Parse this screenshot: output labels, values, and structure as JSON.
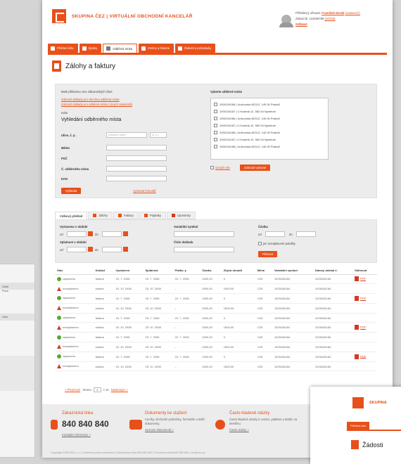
{
  "header": {
    "brand": "SKUPINA ČEZ | VIRTUÁLNÍ OBCHODNÍ KANCELÁŘ",
    "user": {
      "line1_label": "Přihlášený uživatel:",
      "line1_name": "František Novák",
      "line1_link": "(nastavení)",
      "line2_label": "Zákazník: 123456789",
      "line2_link": "(změnit)",
      "logout": "Odhlásit"
    }
  },
  "tabs": [
    {
      "label": "Přehled účtu"
    },
    {
      "label": "Zprávy"
    },
    {
      "label": "Odběrná místa"
    },
    {
      "label": "Změny a historie"
    },
    {
      "label": "Žádosti a požadavky"
    }
  ],
  "page_title": "Zálohy a faktury",
  "search": {
    "intro": "Malé přiřazeno více zákaznických čísel",
    "link1": "Zobrazit doklady pro všechna odběrná místa",
    "link2": "Zobrazit doklady pro odběrná místa z jiných zákazníků",
    "or": "nebo",
    "heading": "Vyhledání odběrného místa",
    "fields": [
      {
        "label": "Ulice, č. p.",
        "placeholder": "(názvem ulice)",
        "placeholder2": "(č. p.)"
      },
      {
        "label": "Město"
      },
      {
        "label": "PSČ"
      },
      {
        "label": "Č. odběrného místa"
      },
      {
        "label": "EAN"
      }
    ],
    "search_btn": "Vyhledat",
    "clear_link": "Vymazat formulář",
    "om_heading": "Vyberte odběrné místo",
    "om_items": [
      "1000134186 | Uničovská 4521/2, 140 00 Praha3",
      "1000134187 | U Kostela 12, 582 54 Nymburk",
      "1000134186 | Uničovská 4521/2, 140 00 Praha3",
      "1000134187 | U Kostela 12, 582 54 Nymburk",
      "1000134186 | Uničovská 4521/2, 140 00 Praha3",
      "1000134187 | U Kostela 12, 582 54 Nymburk",
      "1000134186 | Uničovská 4521/2, 140 00 Praha3"
    ],
    "select_all": "označit vše",
    "show_btn": "Zobrazit vybrané"
  },
  "doc_tabs": [
    {
      "label": "Celkový přehled"
    },
    {
      "label": "Zálohy"
    },
    {
      "label": "Faktury"
    },
    {
      "label": "Poplatky"
    },
    {
      "label": "Upomínky"
    }
  ],
  "filter": {
    "issued_label": "Vystaveno v období",
    "due_label": "Splatnost v období",
    "from": "od",
    "to": "do",
    "var_symbol": "Variabilní symbol",
    "doc_number": "Číslo dokladu",
    "amount": "Částka",
    "unpaid_only": "jen nezaplacené položky",
    "filter_btn": "Filtrovat"
  },
  "table": {
    "headers": [
      "Stav",
      "Doklad",
      "Vystaveno",
      "Splatnost",
      "Platba ▲",
      "Částka",
      "Zbývá uhradit",
      "Měna",
      "Variabilní symbol",
      "Datový doklad č.",
      "Stáhnout"
    ],
    "rows": [
      {
        "status": "zaplaceno",
        "paid": true,
        "doc": "faktura",
        "issued": "15. 7. 2008",
        "due": "25. 7. 2008",
        "payment": "20. 7. 2008",
        "amount": "1500,00",
        "remaining": "0",
        "currency": "CZK",
        "vs": "1025426184",
        "dd": "1025426184",
        "pdf": "PDF"
      },
      {
        "status": "nezaplaceno",
        "paid": false,
        "doc": "záloha",
        "issued": "15. 10. 2008",
        "due": "25. 10. 2008",
        "payment": "–",
        "amount": "1500,00",
        "remaining": "1500,00",
        "currency": "CZK",
        "vs": "1025426184",
        "dd": "1025426184",
        "pdf": ""
      },
      {
        "status": "zaplaceno",
        "paid": true,
        "doc": "faktura",
        "issued": "15. 7. 2008",
        "due": "25. 7. 2008",
        "payment": "20. 7. 2008",
        "amount": "1500,00",
        "remaining": "0",
        "currency": "CZK",
        "vs": "1025426184",
        "dd": "1025426184",
        "pdf": "PDF"
      },
      {
        "status": "nezaplaceno",
        "paid": false,
        "doc": "záloha",
        "issued": "15. 10. 2008",
        "due": "25. 10. 2008",
        "payment": "–",
        "amount": "1500,00",
        "remaining": "1500,00",
        "currency": "CZK",
        "vs": "1025426184",
        "dd": "1025426184",
        "pdf": ""
      },
      {
        "status": "zaplaceno",
        "paid": true,
        "doc": "faktura",
        "issued": "15. 7. 2008",
        "due": "25. 7. 2008",
        "payment": "20. 7. 2008",
        "amount": "1500,00",
        "remaining": "0",
        "currency": "CZK",
        "vs": "1025426184",
        "dd": "1025426184",
        "pdf": ""
      },
      {
        "status": "nezaplaceno",
        "paid": false,
        "doc": "záloha",
        "issued": "15. 10. 2008",
        "due": "25. 10. 2008",
        "payment": "–",
        "amount": "1500,00",
        "remaining": "1500,00",
        "currency": "CZK",
        "vs": "1025426184",
        "dd": "1025426184",
        "pdf": "PDF"
      },
      {
        "status": "zaplaceno",
        "paid": true,
        "doc": "faktura",
        "issued": "15. 7. 2008",
        "due": "25. 7. 2008",
        "payment": "20. 7. 2008",
        "amount": "1500,00",
        "remaining": "0",
        "currency": "CZK",
        "vs": "1025426184",
        "dd": "1025426184",
        "pdf": ""
      },
      {
        "status": "nezaplaceno",
        "paid": false,
        "doc": "záloha",
        "issued": "15. 10. 2008",
        "due": "25. 10. 2008",
        "payment": "–",
        "amount": "1500,00",
        "remaining": "1500,00",
        "currency": "CZK",
        "vs": "1025426184",
        "dd": "1025426184",
        "pdf": ""
      },
      {
        "status": "zaplaceno",
        "paid": true,
        "doc": "faktura",
        "issued": "15. 7. 2008",
        "due": "25. 7. 2008",
        "payment": "20. 7. 2008",
        "amount": "1500,00",
        "remaining": "0",
        "currency": "CZK",
        "vs": "1025426184",
        "dd": "1025426184",
        "pdf": "PDF"
      },
      {
        "status": "nezaplaceno",
        "paid": false,
        "doc": "záloha",
        "issued": "15. 10. 2008",
        "due": "25. 10. 2008",
        "payment": "–",
        "amount": "1500,00",
        "remaining": "1500,00",
        "currency": "CZK",
        "vs": "1025426184",
        "dd": "1025426184",
        "pdf": ""
      }
    ]
  },
  "pager": {
    "prev": "« Předchozí",
    "page_label": "Strana",
    "page": "1",
    "of": "z 10",
    "next": "Následující »"
  },
  "footer": {
    "c1_title": "Zákaznická linka",
    "c1_phone": "840 840 840",
    "c1_link": "Kontaktní informace »",
    "c2_title": "Dokumenty ke stažení",
    "c2_text": "Ceníky, obchodní podmínky, formuláře a další dokumenty.",
    "c2_link": "Seznam dokumentů »",
    "c3_title": "Často kladené otázky",
    "c3_text": "Často kladené otázky k cenám, platbám a datům za elektřinu.",
    "c3_link": "Časté otázky »",
    "copyright": "Copyright 2008 ČEZ, a. s. | Všechna práva vyhrazena | Zákaznická linka 840 840 840 | Poruchová linka 840 850 860 | cez@cez.cz"
  },
  "overlay": {
    "brand": "SKUPINA",
    "tab": "Přehled účtu",
    "title": "Žádosti"
  },
  "background": {
    "left_frag1": "Zadit",
    "left_frag2": "Pozs",
    "left_frag3": "Ulist"
  },
  "colors": {
    "accent": "#e8501a",
    "paid": "#5aa830",
    "unpaid": "#d43a1f"
  }
}
